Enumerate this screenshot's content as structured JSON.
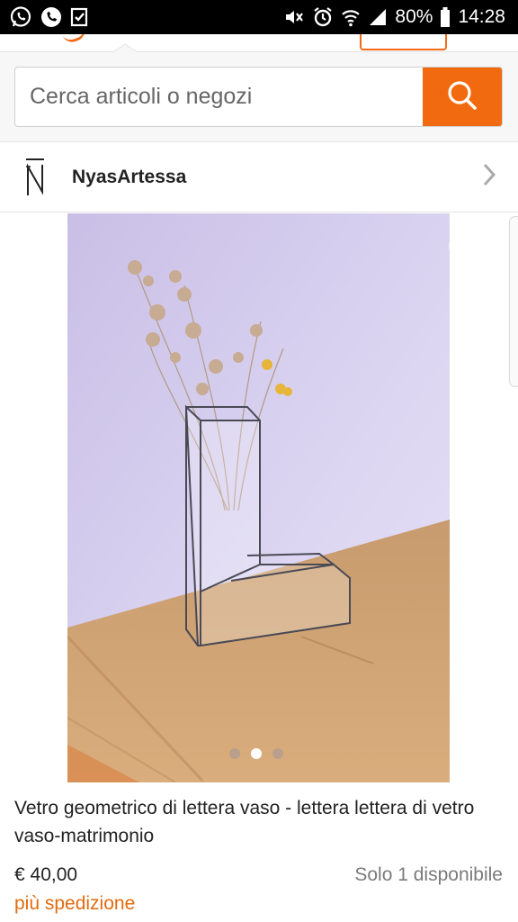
{
  "status_bar": {
    "battery": "80%",
    "time": "14:28",
    "left_icons": [
      "whatsapp-icon",
      "phone-icon",
      "checkbox-icon"
    ],
    "right_icons": [
      "mute-icon",
      "alarm-icon",
      "wifi-icon",
      "signal-icon",
      "battery-icon"
    ]
  },
  "search": {
    "placeholder": "Cerca articoli o negozi",
    "button_icon": "search-icon",
    "accent_color": "#f26a0f"
  },
  "shop": {
    "name": "NyasArtessa",
    "logo_icon": "shop-logo-icon",
    "chevron_icon": "chevron-right-icon"
  },
  "product": {
    "title": "Vetro geometrico di lettera vaso - lettera lettera di vetro vaso-matrimonio",
    "price": "€ 40,00",
    "availability": "Solo 1 disponibile",
    "shipping": "più spedizione",
    "favorite_icon": "heart-icon",
    "carousel": {
      "total": 3,
      "active_index": 1
    }
  },
  "colors": {
    "brand": "#f26a0f",
    "shipping_text": "#e26b0f"
  }
}
